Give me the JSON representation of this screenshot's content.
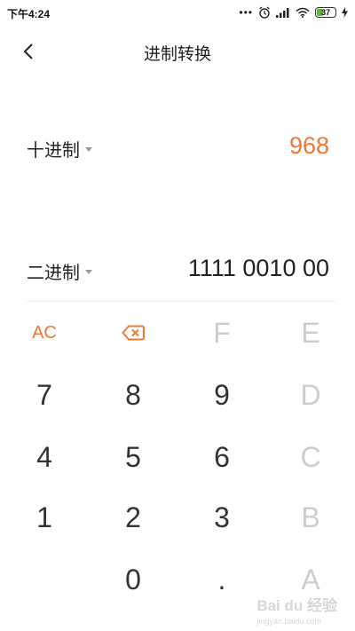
{
  "status_bar": {
    "time": "下午4:24",
    "battery_level": 37,
    "battery_label": "37",
    "battery_color": "#5fb832"
  },
  "header": {
    "title": "进制转换",
    "back_icon": "chevron-left-icon"
  },
  "converter": {
    "source": {
      "base_label": "十进制",
      "value": "968"
    },
    "target": {
      "base_label": "二进制",
      "value": "1111 0010 00"
    }
  },
  "keypad": {
    "clear_label": "AC",
    "backspace_icon": "backspace-icon",
    "keys": {
      "f": "F",
      "e": "E",
      "seven": "7",
      "eight": "8",
      "nine": "9",
      "d": "D",
      "four": "4",
      "five": "5",
      "six": "6",
      "c": "C",
      "one": "1",
      "two": "2",
      "three": "3",
      "b": "B",
      "zero": "0",
      "dot": ".",
      "a": "A"
    }
  },
  "colors": {
    "accent": "#ee7733",
    "disabled": "#cdcdcd",
    "text": "#222222"
  },
  "watermark": {
    "text": "Bai du 经验",
    "sub": "jingyan.baidu.com"
  }
}
